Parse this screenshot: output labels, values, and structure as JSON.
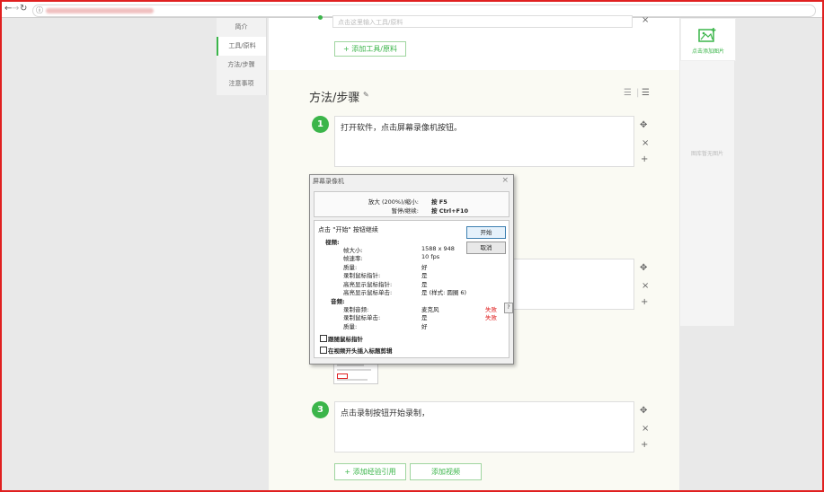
{
  "browser": {
    "back_icon": "arrow-left-icon",
    "forward_icon": "arrow-right-icon",
    "reload_icon": "reload-icon",
    "info_icon": "info-icon"
  },
  "sidebar": {
    "items": [
      {
        "label": "简介",
        "active": false
      },
      {
        "label": "工具/原料",
        "active": true
      },
      {
        "label": "方法/步骤",
        "active": false
      },
      {
        "label": "注意事项",
        "active": false
      }
    ]
  },
  "tools": {
    "placeholder": "点击这里输入工具/原料",
    "add_button": "+ 添加工具/原料"
  },
  "steps_section": {
    "title": "方法/步骤"
  },
  "steps": [
    {
      "number": "1",
      "text": "打开软件，点击屏幕录像机按钮。"
    },
    {
      "number": "3",
      "text": "点击录制按钮开始录制，"
    }
  ],
  "bottom_buttons": {
    "add_reference": "+ 添加经验引用",
    "add_video": "添加视频"
  },
  "right_panel": {
    "add_image_label": "点击添加图片",
    "no_image_label": "图库暂无图片"
  },
  "recorder_dialog": {
    "title": "屏幕录像机",
    "hotkeys": [
      {
        "label": "放大 (200%)/缩小:",
        "key": "按 F5"
      },
      {
        "label": "暂停/继续:",
        "key": "按 Ctrl+F10"
      }
    ],
    "instruction": "点击 \"开始\" 按钮继续",
    "start_button": "开始",
    "cancel_button": "取消",
    "video_header": "视频:",
    "video_rows": [
      {
        "label": "帧大小:",
        "value": "1588 x 948"
      },
      {
        "label": "帧速率:",
        "value": "10 fps"
      },
      {
        "label": "质量:",
        "value": "好"
      },
      {
        "label": "录制鼠标指针:",
        "value": "是"
      },
      {
        "label": "高亮显示鼠标指针:",
        "value": "是"
      },
      {
        "label": "高亮显示鼠标单击:",
        "value": "是 (样式: 圆圈 6)"
      }
    ],
    "audio_header": "音频:",
    "audio_rows": [
      {
        "label": "录制音频:",
        "value": "麦克风",
        "status": "失败"
      },
      {
        "label": "录制鼠标单击:",
        "value": "是",
        "status": "失败"
      },
      {
        "label": "质量:",
        "value": "好",
        "status": ""
      }
    ],
    "help_label": "?",
    "checkbox_follow_mouse": "跟随鼠标指针",
    "checkbox_insert_title": "在视频开头插入标题剪辑"
  },
  "colors": {
    "accent": "#3bb54a",
    "fail": "#e02020",
    "frame": "#e02020"
  }
}
